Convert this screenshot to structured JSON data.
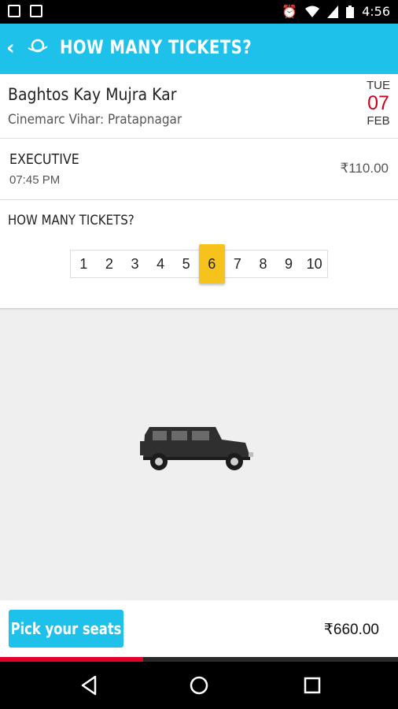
{
  "status_bar": {
    "time": "4:56",
    "icons": [
      "image-icon",
      "sd-card-icon",
      "alarm-icon",
      "wifi-icon",
      "signal-icon",
      "battery-icon"
    ]
  },
  "app_bar": {
    "title": "HOW MANY TICKETS?",
    "logo_text": "CINEMARC",
    "back_icon": "chevron-left-icon",
    "color": "#1ec1ea"
  },
  "movie": {
    "title": "Baghtos Kay Mujra Kar",
    "cinema": "Cinemarc Vihar: Pratapnagar",
    "date": {
      "dow": "TUE",
      "day": "07",
      "month": "FEB"
    }
  },
  "show": {
    "class": "EXECUTIVE",
    "time": "07:45 PM",
    "price": "₹110.00"
  },
  "quantity": {
    "label": "HOW MANY TICKETS?",
    "options": [
      "1",
      "2",
      "3",
      "4",
      "5",
      "6",
      "7",
      "8",
      "9",
      "10"
    ],
    "selected": "6",
    "selected_color": "#f6c31c"
  },
  "illustration": {
    "icon": "jeep-icon"
  },
  "footer": {
    "button_label": "Pick your seats",
    "total": "₹660.00",
    "progress": 0.36
  },
  "nav_bar": {
    "icons": [
      "back-triangle-icon",
      "home-circle-icon",
      "recents-square-icon"
    ]
  }
}
